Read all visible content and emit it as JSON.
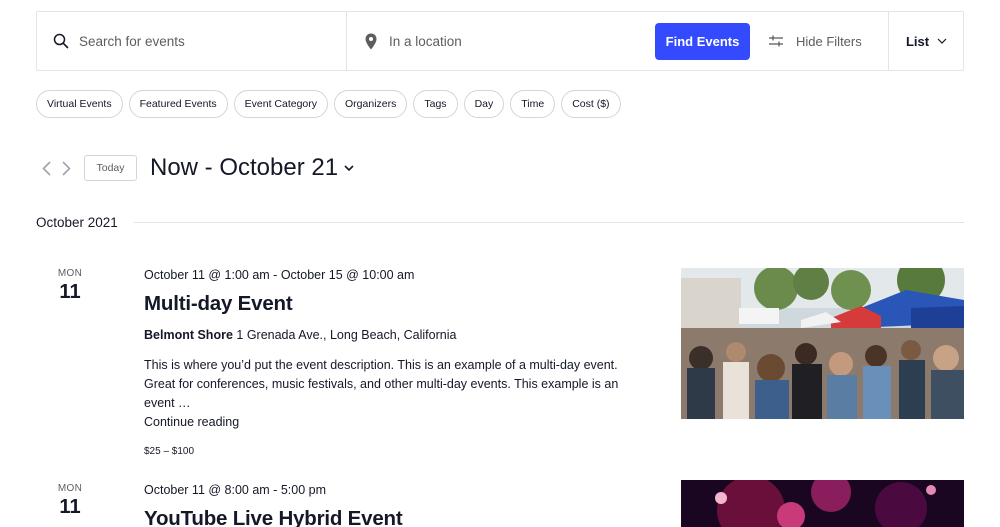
{
  "search": {
    "keyword_placeholder": "Search for events",
    "location_placeholder": "In a location",
    "find_button": "Find Events",
    "hide_filters": "Hide Filters",
    "view": "List",
    "accent_color": "#334aff"
  },
  "filters": [
    "Virtual Events",
    "Featured Events",
    "Event Category",
    "Organizers",
    "Tags",
    "Day",
    "Time",
    "Cost ($)"
  ],
  "date_nav": {
    "today": "Today",
    "range": "Now - October 21"
  },
  "month_separator": "October 2021",
  "events": [
    {
      "dow": "MON",
      "day": "11",
      "when": "October 11 @ 1:00 am - October 15 @ 10:00 am",
      "title": "Multi-day Event",
      "venue_name": "Belmont Shore",
      "venue_address": "1 Grenada Ave., Long Beach, California",
      "description": "This is where you’d put the event description. This is an example of a multi-day event. Great for conferences, music festivals, and other multi-day events. This example is an event …",
      "read_more": "Continue reading",
      "cost": "$25 – $100",
      "image": "street-festival-crowd-photo"
    },
    {
      "dow": "MON",
      "day": "11",
      "when": "October 11 @ 8:00 am - 5:00 pm",
      "title": "YouTube Live Hybrid Event",
      "image": "concert-stage-photo"
    }
  ]
}
